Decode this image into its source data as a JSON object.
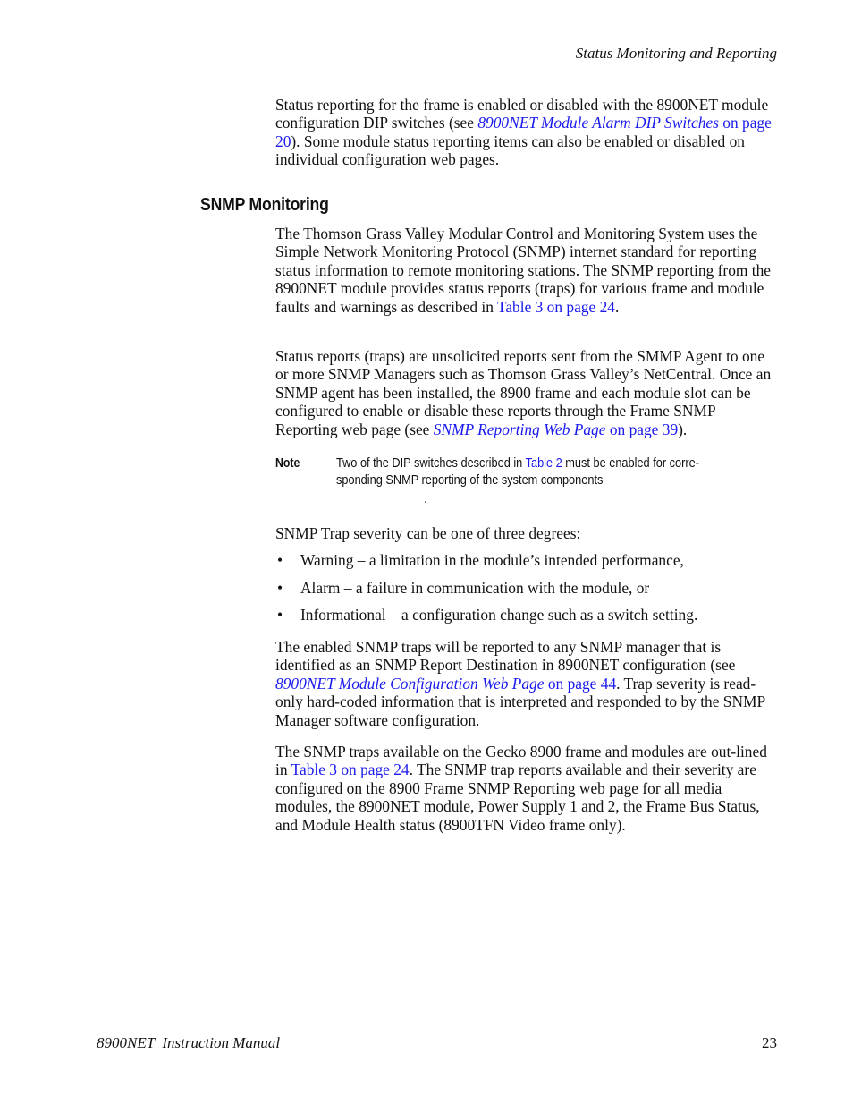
{
  "header": {
    "running_title": "Status Monitoring and Reporting"
  },
  "intro": {
    "text_1": "Status reporting for the frame is enabled or disabled with the 8900NET module configuration DIP switches (see ",
    "link_italic": "8900NET Module Alarm DIP Switches",
    "link_page": " on page 20",
    "text_2": "). Some module status reporting items can also be enabled or disabled on individual configuration web pages."
  },
  "section": {
    "heading": "SNMP Monitoring",
    "para1": {
      "text_1": "The Thomson Grass Valley Modular Control and Monitoring System uses the Simple Network Monitoring Protocol (SNMP) internet standard for reporting status information to remote monitoring stations. The SNMP reporting from the 8900NET module provides status reports (traps) for various frame and module faults and warnings as described in ",
      "link": "Table 3 on page 24",
      "text_2": "."
    },
    "para2": {
      "text_1": "Status reports (traps) are unsolicited reports sent from the SMMP Agent to one or more SNMP Managers such as Thomson Grass Valley’s NetCentral. Once an SNMP agent has been installed, the 8900 frame and each module slot can be configured to enable or disable these reports through the Frame SNMP Reporting web page (see ",
      "link_italic": "SNMP Reporting Web Page",
      "link_page": " on page 39",
      "text_2": ")."
    },
    "note": {
      "label": "Note",
      "text_1": "Two of the DIP switches described in ",
      "link": "Table 2",
      "text_2": " must be enabled for corre-",
      "line2": "sponding SNMP reporting of the system components",
      "trailing": "."
    },
    "severity_intro": "SNMP Trap severity can be one of three degrees:",
    "severity_items": [
      "Warning – a limitation in the module’s intended performance,",
      "Alarm – a failure in communication with the module, or",
      "Informational – a configuration change such as a switch setting."
    ],
    "bullet_glyph": "•",
    "para3": {
      "text_1": "The enabled SNMP traps will be reported to any SNMP manager that is identified as an SNMP Report Destination in 8900NET configuration (see ",
      "link_italic": "8900NET Module Configuration Web Page",
      "link_page": " on page 44",
      "text_2": ". Trap severity is read-only hard-coded information that is interpreted and responded to by the SNMP Manager software configuration."
    },
    "para4": {
      "text_1": "The SNMP traps available on the Gecko 8900 frame and modules are out-lined in ",
      "link": "Table 3 on page 24",
      "text_2": ". The SNMP trap reports available and their severity are configured on the 8900 Frame SNMP Reporting web page for all media modules, the 8900NET module, Power Supply 1 and 2, the Frame Bus Status, and Module Health status (8900TFN Video frame only)."
    }
  },
  "footer": {
    "manual_title": "8900NET  Instruction Manual",
    "page_number": "23"
  }
}
